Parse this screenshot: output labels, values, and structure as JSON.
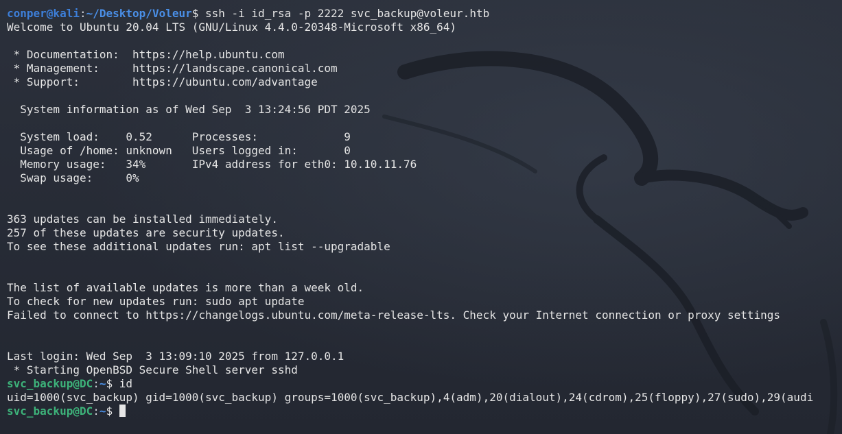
{
  "colors": {
    "background": "#262b36",
    "text": "#e6e6e6",
    "local_prompt_user": "#3d7fd9",
    "path": "#4a8fe7",
    "remote_prompt_user": "#3db37a"
  },
  "icons": {
    "watermark": "kali-dragon-icon"
  },
  "prompts": {
    "local": {
      "user": "conper@kali",
      "sep": ":",
      "path": "~/Desktop/Voleur",
      "symbol": "$ ",
      "command": "ssh -i id_rsa -p 2222 svc_backup@voleur.htb"
    },
    "remote1": {
      "user": "svc_backup@DC",
      "sep": ":",
      "path": "~",
      "symbol": "$ ",
      "command": "id"
    },
    "remote2": {
      "user": "svc_backup@DC",
      "sep": ":",
      "path": "~",
      "symbol": "$ "
    }
  },
  "output": {
    "welcome": "Welcome to Ubuntu 20.04 LTS (GNU/Linux 4.4.0-20348-Microsoft x86_64)",
    "blank1": "",
    "doc": " * Documentation:  https://help.ubuntu.com",
    "mgmt": " * Management:     https://landscape.canonical.com",
    "support": " * Support:        https://ubuntu.com/advantage",
    "blank2": "",
    "sysinfo": "  System information as of Wed Sep  3 13:24:56 PDT 2025",
    "blank3": "",
    "sysload": "  System load:    0.52      Processes:             9",
    "usage_home": "  Usage of /home: unknown   Users logged in:       0",
    "memory": "  Memory usage:   34%       IPv4 address for eth0: 10.10.11.76",
    "swap": "  Swap usage:     0%",
    "blank4": "",
    "blank5": "",
    "updates_count": "363 updates can be installed immediately.",
    "security_updates": "257 of these updates are security updates.",
    "updates_hint": "To see these additional updates run: apt list --upgradable",
    "blank6": "",
    "blank7": "",
    "list_old": "The list of available updates is more than a week old.",
    "check_updates": "To check for new updates run: sudo apt update",
    "failed_connect": "Failed to connect to https://changelogs.ubuntu.com/meta-release-lts. Check your Internet connection or proxy settings",
    "blank8": "",
    "blank9": "",
    "last_login": "Last login: Wed Sep  3 13:09:10 2025 from 127.0.0.1",
    "starting_sshd": " * Starting OpenBSD Secure Shell server sshd",
    "id_output": "uid=1000(svc_backup) gid=1000(svc_backup) groups=1000(svc_backup),4(adm),20(dialout),24(cdrom),25(floppy),27(sudo),29(audi"
  }
}
